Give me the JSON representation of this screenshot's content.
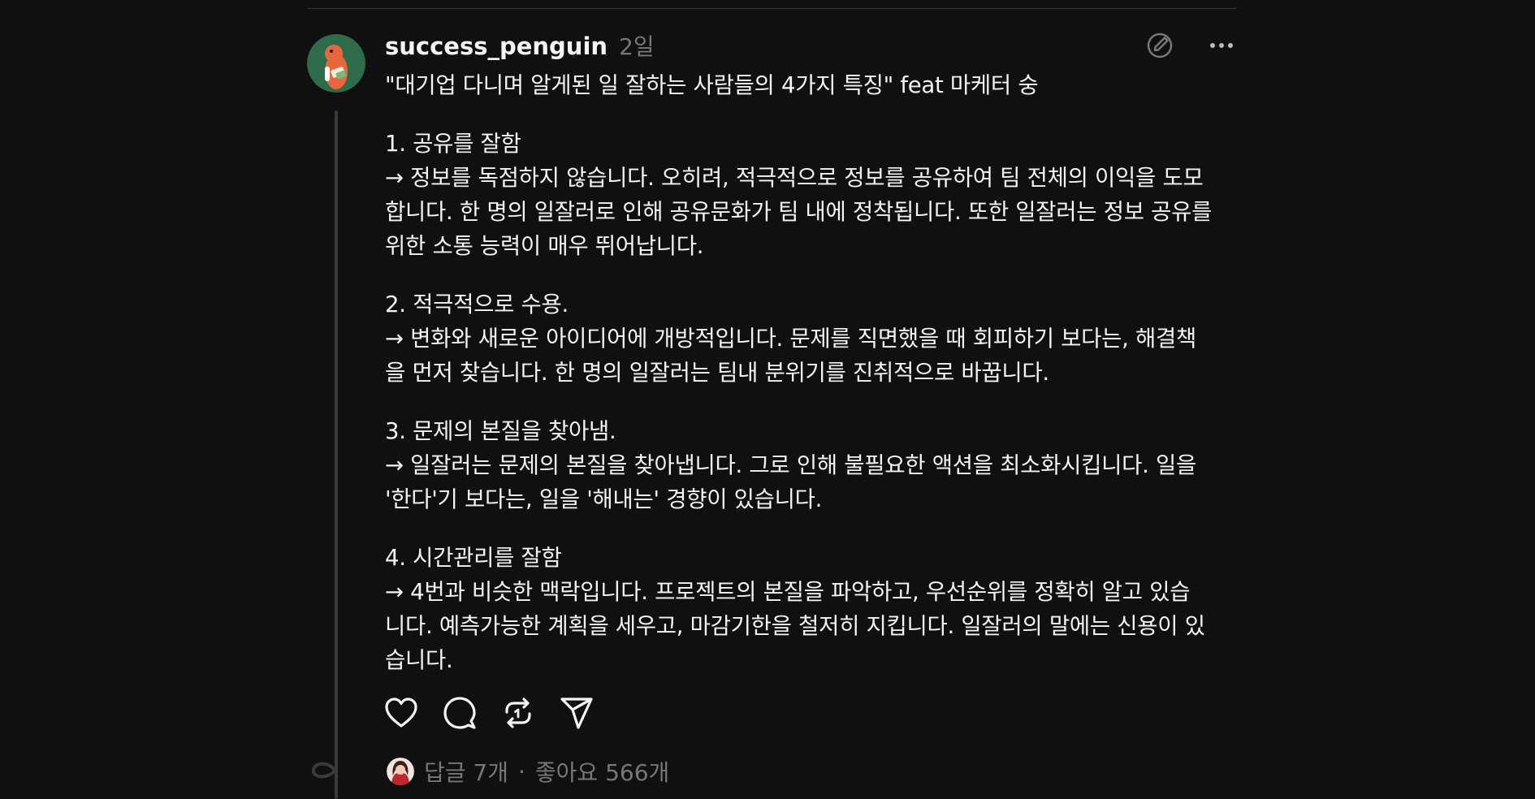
{
  "post": {
    "username": "success_penguin",
    "time": "2일",
    "lines": [
      "\"대기업 다니며 알게된 일 잘하는 사람들의 4가지 특징\" feat 마케터 숭",
      "",
      "1. 공유를 잘함",
      "→ 정보를 독점하지 않습니다. 오히려, 적극적으로 정보를 공유하여 팀 전체의 이익을 도모",
      "합니다. 한 명의 일잘러로 인해 공유문화가 팀 내에 정착됩니다. 또한 일잘러는 정보 공유를",
      "위한 소통 능력이 매우 뛰어납니다.",
      "",
      "2. 적극적으로 수용.",
      "→ 변화와 새로운 아이디어에 개방적입니다. 문제를 직면했을 때 회피하기 보다는, 해결책",
      "을 먼저 찾습니다. 한 명의 일잘러는 팀내 분위기를 진취적으로 바꿉니다.",
      "",
      "3. 문제의 본질을 찾아냄.",
      "→ 일잘러는 문제의 본질을 찾아냅니다. 그로 인해 불필요한 액션을 최소화시킵니다. 일을",
      "'한다'기 보다는, 일을 '해내는' 경향이 있습니다.",
      "",
      "4. 시간관리를 잘함",
      "→ 4번과 비슷한 맥락입니다. 프로젝트의 본질을 파악하고, 우선순위를 정확히 알고 있습",
      "니다. 예측가능한 계획을 세우고, 마감기한을 철저히 지킵니다. 일잘러의 말에는 신용이 있",
      "습니다."
    ]
  },
  "footer": {
    "replies": "답글 7개",
    "separator": "·",
    "likes": "좋아요 566개"
  },
  "icons": {
    "edit": "edit-circle-icon",
    "more": "more-horizontal-icon",
    "like": "heart-icon",
    "comment": "comment-bubble-icon",
    "repost": "repost-icon",
    "share": "send-icon"
  },
  "colors": {
    "background": "#101010",
    "text_primary": "#f3f5f7",
    "text_secondary": "#777777",
    "avatar_bg": "#2e6b4a",
    "avatar_character": "#e8663d"
  }
}
